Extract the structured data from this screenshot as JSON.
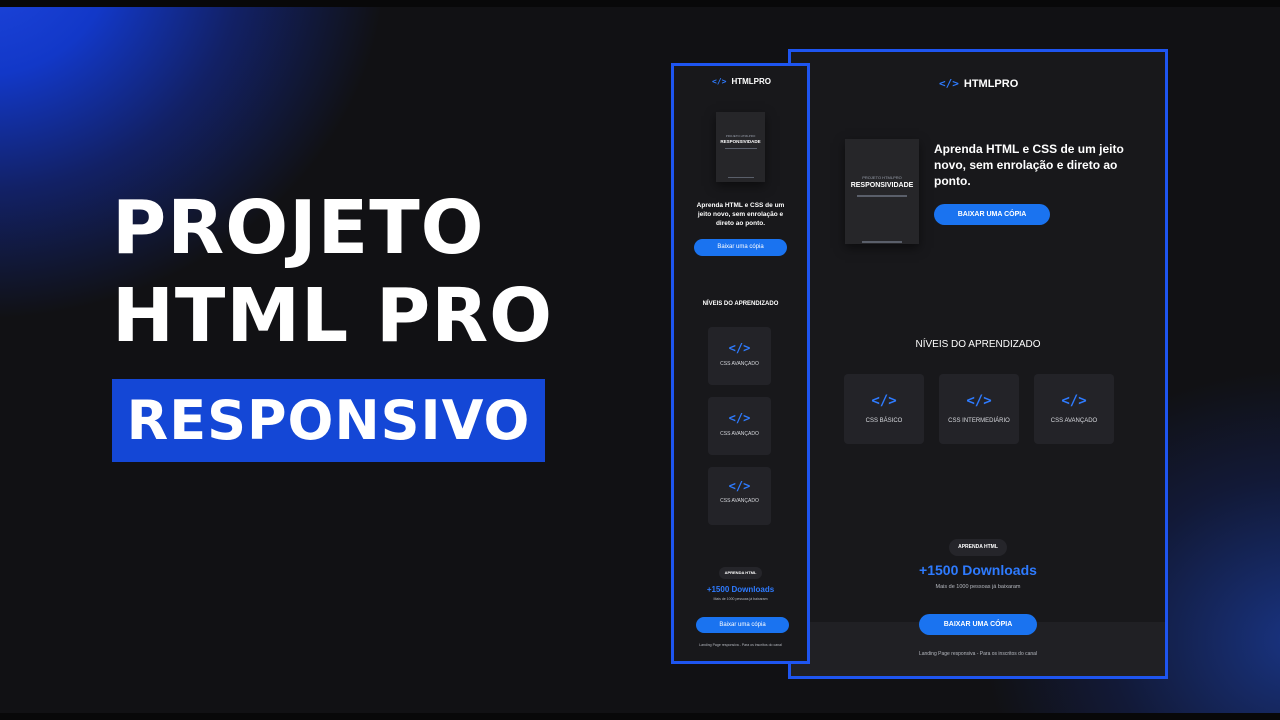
{
  "headline": {
    "line1": "PROJETO",
    "line2": "HTML PRO"
  },
  "badge": {
    "label": "RESPONSIVO"
  },
  "colors": {
    "accent": "#1447d6",
    "frame_border": "#1e55f0",
    "button": "#1a73f0",
    "link_blue": "#2e7bff",
    "panel_bg": "#18181b"
  },
  "desktop": {
    "logo_icon": "code-brackets-icon",
    "logo_symbol": "</>",
    "logo_text": "HTMLPRO",
    "book": {
      "small": "PROJETO HTMLPRO",
      "title": "RESPONSIVIDADE"
    },
    "hero_text": "Aprenda HTML e CSS de um jeito novo, sem enrolação e direto ao ponto.",
    "hero_button": "BAIXAR UMA CÓPIA",
    "levels_title": "NÍVEIS DO APRENDIZADO",
    "levels": [
      {
        "icon": "</>",
        "label": "CSS BÁSICO"
      },
      {
        "icon": "</>",
        "label": "CSS INTERMEDIÁRIO"
      },
      {
        "icon": "</>",
        "label": "CSS AVANÇADO"
      }
    ],
    "pill": "APRENDA HTML",
    "downloads": "+1500 Downloads",
    "downloads_sub": "Mais de 1000 pessoas já baixaram",
    "cta_button": "BAIXAR UMA CÓPIA",
    "footer": "Landing Page responsiva - Para os inscritos do canal"
  },
  "mobile": {
    "logo_symbol": "</>",
    "logo_text": "HTMLPRO",
    "book": {
      "small": "PROJETO HTMLPRO",
      "title": "RESPONSIVIDADE"
    },
    "hero_text": "Aprenda HTML e CSS de um jeito novo, sem enrolação e direto ao ponto.",
    "hero_button": "Baixar uma cópia",
    "levels_title": "NÍVEIS DO APRENDIZADO",
    "levels": [
      {
        "icon": "</>",
        "label": "CSS AVANÇADO"
      },
      {
        "icon": "</>",
        "label": "CSS AVANÇADO"
      },
      {
        "icon": "</>",
        "label": "CSS AVANÇADO"
      }
    ],
    "pill": "APRENDA HTML",
    "downloads": "+1500 Downloads",
    "downloads_sub": "Mais de 1000 pessoas já baixaram",
    "cta_button": "Baixar uma cópia",
    "footer": "Landing Page responsiva - Para os inscritos do canal"
  }
}
